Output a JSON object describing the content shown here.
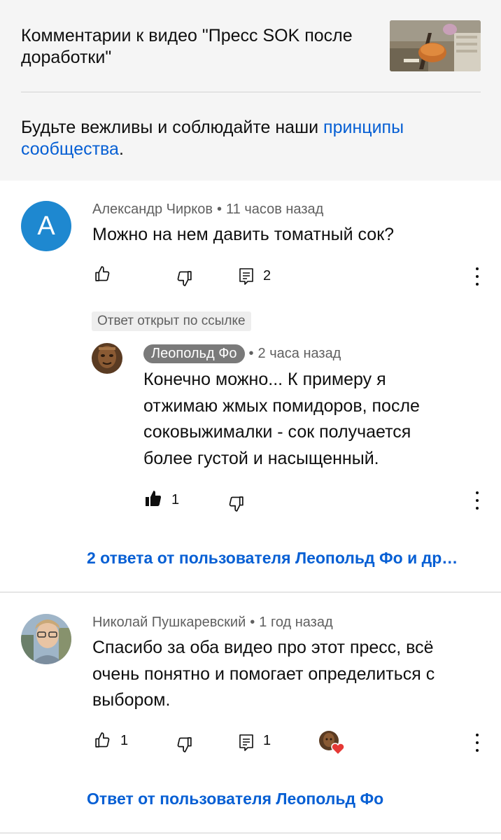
{
  "header": {
    "video_title": "Комментарии к видео \"Пресс SOK после доработки\"",
    "guidelines_prefix": "Будьте вежливы и соблюдайте наши ",
    "guidelines_link": "принципы сообщества",
    "guidelines_suffix": "."
  },
  "comments": [
    {
      "avatar_letter": "А",
      "author": "Александр Чирков",
      "time": "11 часов назад",
      "text": "Можно на нем давить томатный сок?",
      "likes": "",
      "replies_count": "2",
      "reply_link": "2 ответа от пользователя Леопольд Фо и др…",
      "pinned_label": "Ответ открыт по ссылке",
      "highlighted_reply": {
        "author": "Леопольд Фо",
        "time": "2 часа назад",
        "text_lines": [
          "Конечно можно... К примеру я",
          "отжимаю жмых помидоров, после",
          "соковыжималки - сок получается",
          "более густой и насыщенный."
        ],
        "likes": "1"
      }
    },
    {
      "author": "Николай Пушкаревский",
      "time": "1 год назад",
      "text_lines": [
        "Спасибо за оба видео про этот пресс, всё",
        "очень понятно и помогает определиться с",
        "выбором."
      ],
      "likes": "1",
      "replies_count": "1",
      "reply_link": "Ответ от пользователя Леопольд Фо"
    }
  ],
  "colors": {
    "link": "#065fd4",
    "avatar_blue": "#1e88d0",
    "heart": "#e53935"
  }
}
